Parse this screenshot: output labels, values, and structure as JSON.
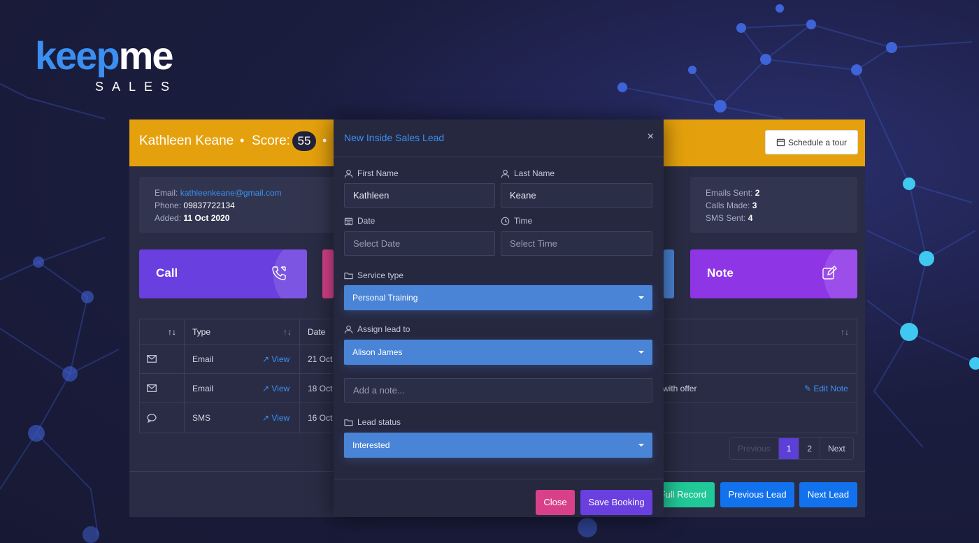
{
  "logo": {
    "brand_a": "keep",
    "brand_b": "me",
    "subtitle": "SALES"
  },
  "lead": {
    "name": "Kathleen Keane",
    "score_label": "Score:",
    "score": "55",
    "schedule_tour_label": "Schedule a tour"
  },
  "contact": {
    "email_label": "Email:",
    "email": "kathleenkeane@gmail.com",
    "phone_label": "Phone:",
    "phone": "09837722134",
    "added_label": "Added:",
    "added": "11 Oct 2020"
  },
  "stats": {
    "emails_label": "Emails Sent:",
    "emails": "2",
    "calls_label": "Calls Made:",
    "calls": "3",
    "sms_label": "SMS Sent:",
    "sms": "4"
  },
  "actions": {
    "call": "Call",
    "note": "Note"
  },
  "table": {
    "headers": {
      "type": "Type",
      "date": "Date"
    },
    "rows": [
      {
        "type": "Email",
        "view": "View",
        "date": "21 Oct",
        "details": "",
        "edit": ""
      },
      {
        "type": "Email",
        "view": "View",
        "date": "18 Oct",
        "details": "with offer",
        "edit": "Edit Note"
      },
      {
        "type": "SMS",
        "view": "View",
        "date": "16 Oct",
        "details": "",
        "edit": ""
      }
    ]
  },
  "pagination": {
    "previous": "Previous",
    "pages": [
      "1",
      "2"
    ],
    "next": "Next"
  },
  "footer": {
    "full_record": "Full Record",
    "previous_lead": "Previous Lead",
    "next_lead": "Next Lead"
  },
  "modal": {
    "title": "New Inside Sales Lead",
    "close_symbol": "×",
    "first_name_label": "First Name",
    "first_name": "Kathleen",
    "last_name_label": "Last Name",
    "last_name": "Keane",
    "date_label": "Date",
    "date_placeholder": "Select Date",
    "time_label": "Time",
    "time_placeholder": "Select Time",
    "service_label": "Service type",
    "service_value": "Personal Training",
    "assign_label": "Assign lead to",
    "assign_value": "Alison James",
    "note_placeholder": "Add a note...",
    "status_label": "Lead status",
    "status_value": "Interested",
    "close_button": "Close",
    "save_button": "Save Booking"
  },
  "colors": {
    "header": "#e5a10d",
    "call": "#6a3fe0",
    "note": "#8e36e6",
    "accent_blue": "#3b8ff0",
    "select_blue": "#4a84d6",
    "close_pink": "#d8418a",
    "save_purple": "#6a3fe0",
    "full_record_teal": "#20c997",
    "lead_nav_blue": "#1272ee"
  }
}
